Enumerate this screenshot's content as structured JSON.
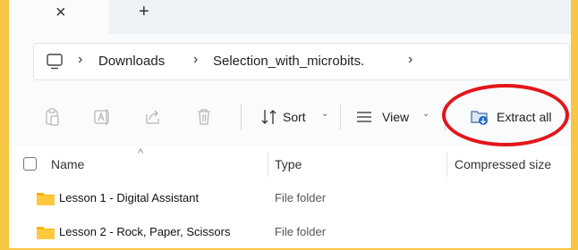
{
  "tabbar": {
    "close_glyph": "×",
    "new_tab_glyph": "+"
  },
  "address": {
    "icon": "computer-icon",
    "separator": "›",
    "crumbs": [
      "Downloads",
      "Selection_with_microbits."
    ],
    "trailing_separator": "›"
  },
  "toolbar": {
    "sort_label": "Sort",
    "view_label": "View",
    "extract_label": "Extract all",
    "chevron": "⌄",
    "highlight_color": "#e3151a"
  },
  "columns": {
    "name": "Name",
    "type": "Type",
    "compressed_size": "Compressed size"
  },
  "rows": [
    {
      "name": "Lesson 1 - Digital Assistant",
      "type": "File folder"
    },
    {
      "name": "Lesson 2 - Rock, Paper, Scissors",
      "type": "File folder"
    }
  ]
}
